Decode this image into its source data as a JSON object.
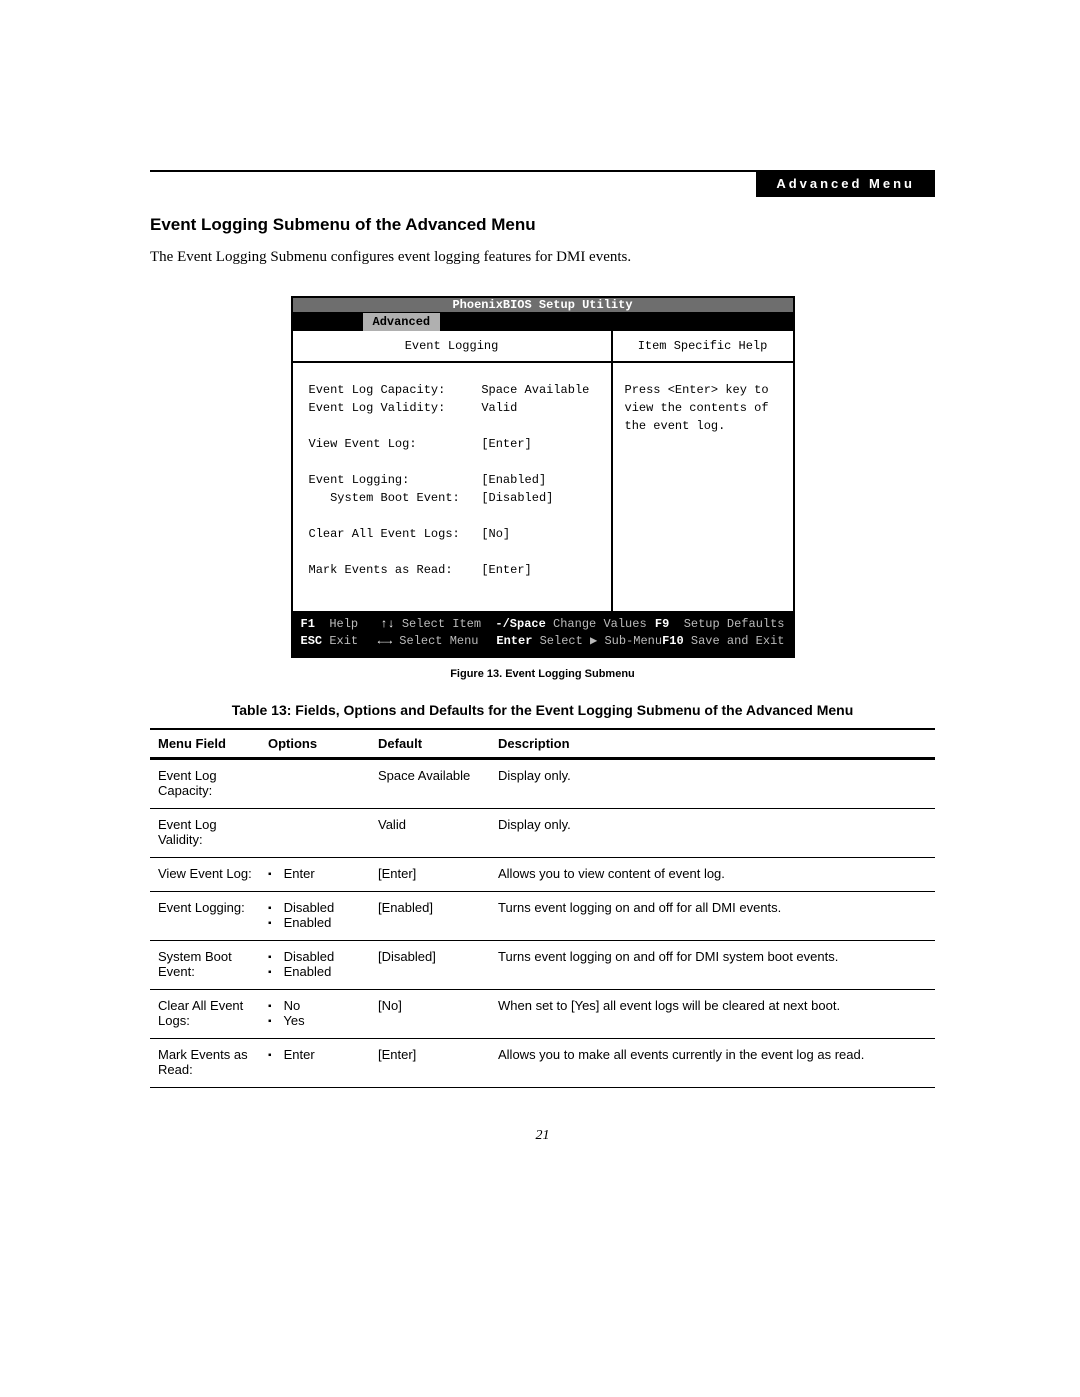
{
  "header_tab": "Advanced Menu",
  "heading": "Event Logging Submenu of the Advanced Menu",
  "lead": "The Event Logging Submenu configures event logging features for DMI events.",
  "bios": {
    "title": "PhoenixBIOS Setup Utility",
    "tab_active": "Advanced",
    "left_header": "Event Logging",
    "right_header": "Item Specific Help",
    "fields": [
      {
        "label": "Event Log Capacity:",
        "value": "Space Available",
        "indent": false,
        "blank_after": false
      },
      {
        "label": "Event Log Validity:",
        "value": "Valid",
        "indent": false,
        "blank_after": true
      },
      {
        "label": "View Event Log:",
        "value": "[Enter]",
        "indent": false,
        "blank_after": true
      },
      {
        "label": "Event Logging:",
        "value": "[Enabled]",
        "indent": false,
        "blank_after": false
      },
      {
        "label": "System Boot Event:",
        "value": "[Disabled]",
        "indent": true,
        "blank_after": true
      },
      {
        "label": "Clear All Event Logs:",
        "value": "[No]",
        "indent": false,
        "blank_after": true
      },
      {
        "label": "Mark Events as Read:",
        "value": "[Enter]",
        "indent": false,
        "blank_after": false
      }
    ],
    "help_text": "Press <Enter> key to view the contents of the event log.",
    "footer": {
      "row1": {
        "c1k": "F1",
        "c1d": "Help",
        "c2k": "↑↓",
        "c2d": "Select Item",
        "c3k": "-/Space",
        "c3d": "Change Values",
        "c4k": "F9",
        "c4d": "Setup Defaults"
      },
      "row2": {
        "c1k": "ESC",
        "c1d": "Exit",
        "c2k": "←→",
        "c2d": "Select Menu",
        "c3k": "Enter",
        "c3d": "Select ▶ Sub-Menu",
        "c4k": "F10",
        "c4d": "Save and Exit"
      }
    }
  },
  "figure_caption": "Figure 13.   Event Logging Submenu",
  "table_title": "Table 13: Fields, Options and Defaults for the Event Logging Submenu of the Advanced Menu",
  "table": {
    "headers": [
      "Menu Field",
      "Options",
      "Default",
      "Description"
    ],
    "rows": [
      {
        "field": "Event Log Capacity:",
        "indent": false,
        "options": [],
        "default": "Space Available",
        "desc": "Display only."
      },
      {
        "field": "Event Log Validity:",
        "indent": false,
        "options": [],
        "default": "Valid",
        "desc": "Display only."
      },
      {
        "field": "View Event Log:",
        "indent": false,
        "options": [
          "Enter"
        ],
        "default": "[Enter]",
        "desc": "Allows you to view content of event log."
      },
      {
        "field": "Event Logging:",
        "indent": false,
        "options": [
          "Disabled",
          "Enabled"
        ],
        "default": "[Enabled]",
        "desc": "Turns event logging on and off for all DMI events."
      },
      {
        "field": "System Boot Event:",
        "indent": true,
        "options": [
          "Disabled",
          "Enabled"
        ],
        "default": "[Disabled]",
        "desc": "Turns event logging on and off for DMI system boot events."
      },
      {
        "field": "Clear All Event Logs:",
        "indent": false,
        "options": [
          "No",
          "Yes"
        ],
        "default": "[No]",
        "desc": "When set to [Yes] all event logs will be cleared at next boot."
      },
      {
        "field": "Mark Events as Read:",
        "indent": false,
        "options": [
          "Enter"
        ],
        "default": "[Enter]",
        "desc": "Allows you to make all events currently in the event log as read."
      }
    ]
  },
  "page_number": "21"
}
